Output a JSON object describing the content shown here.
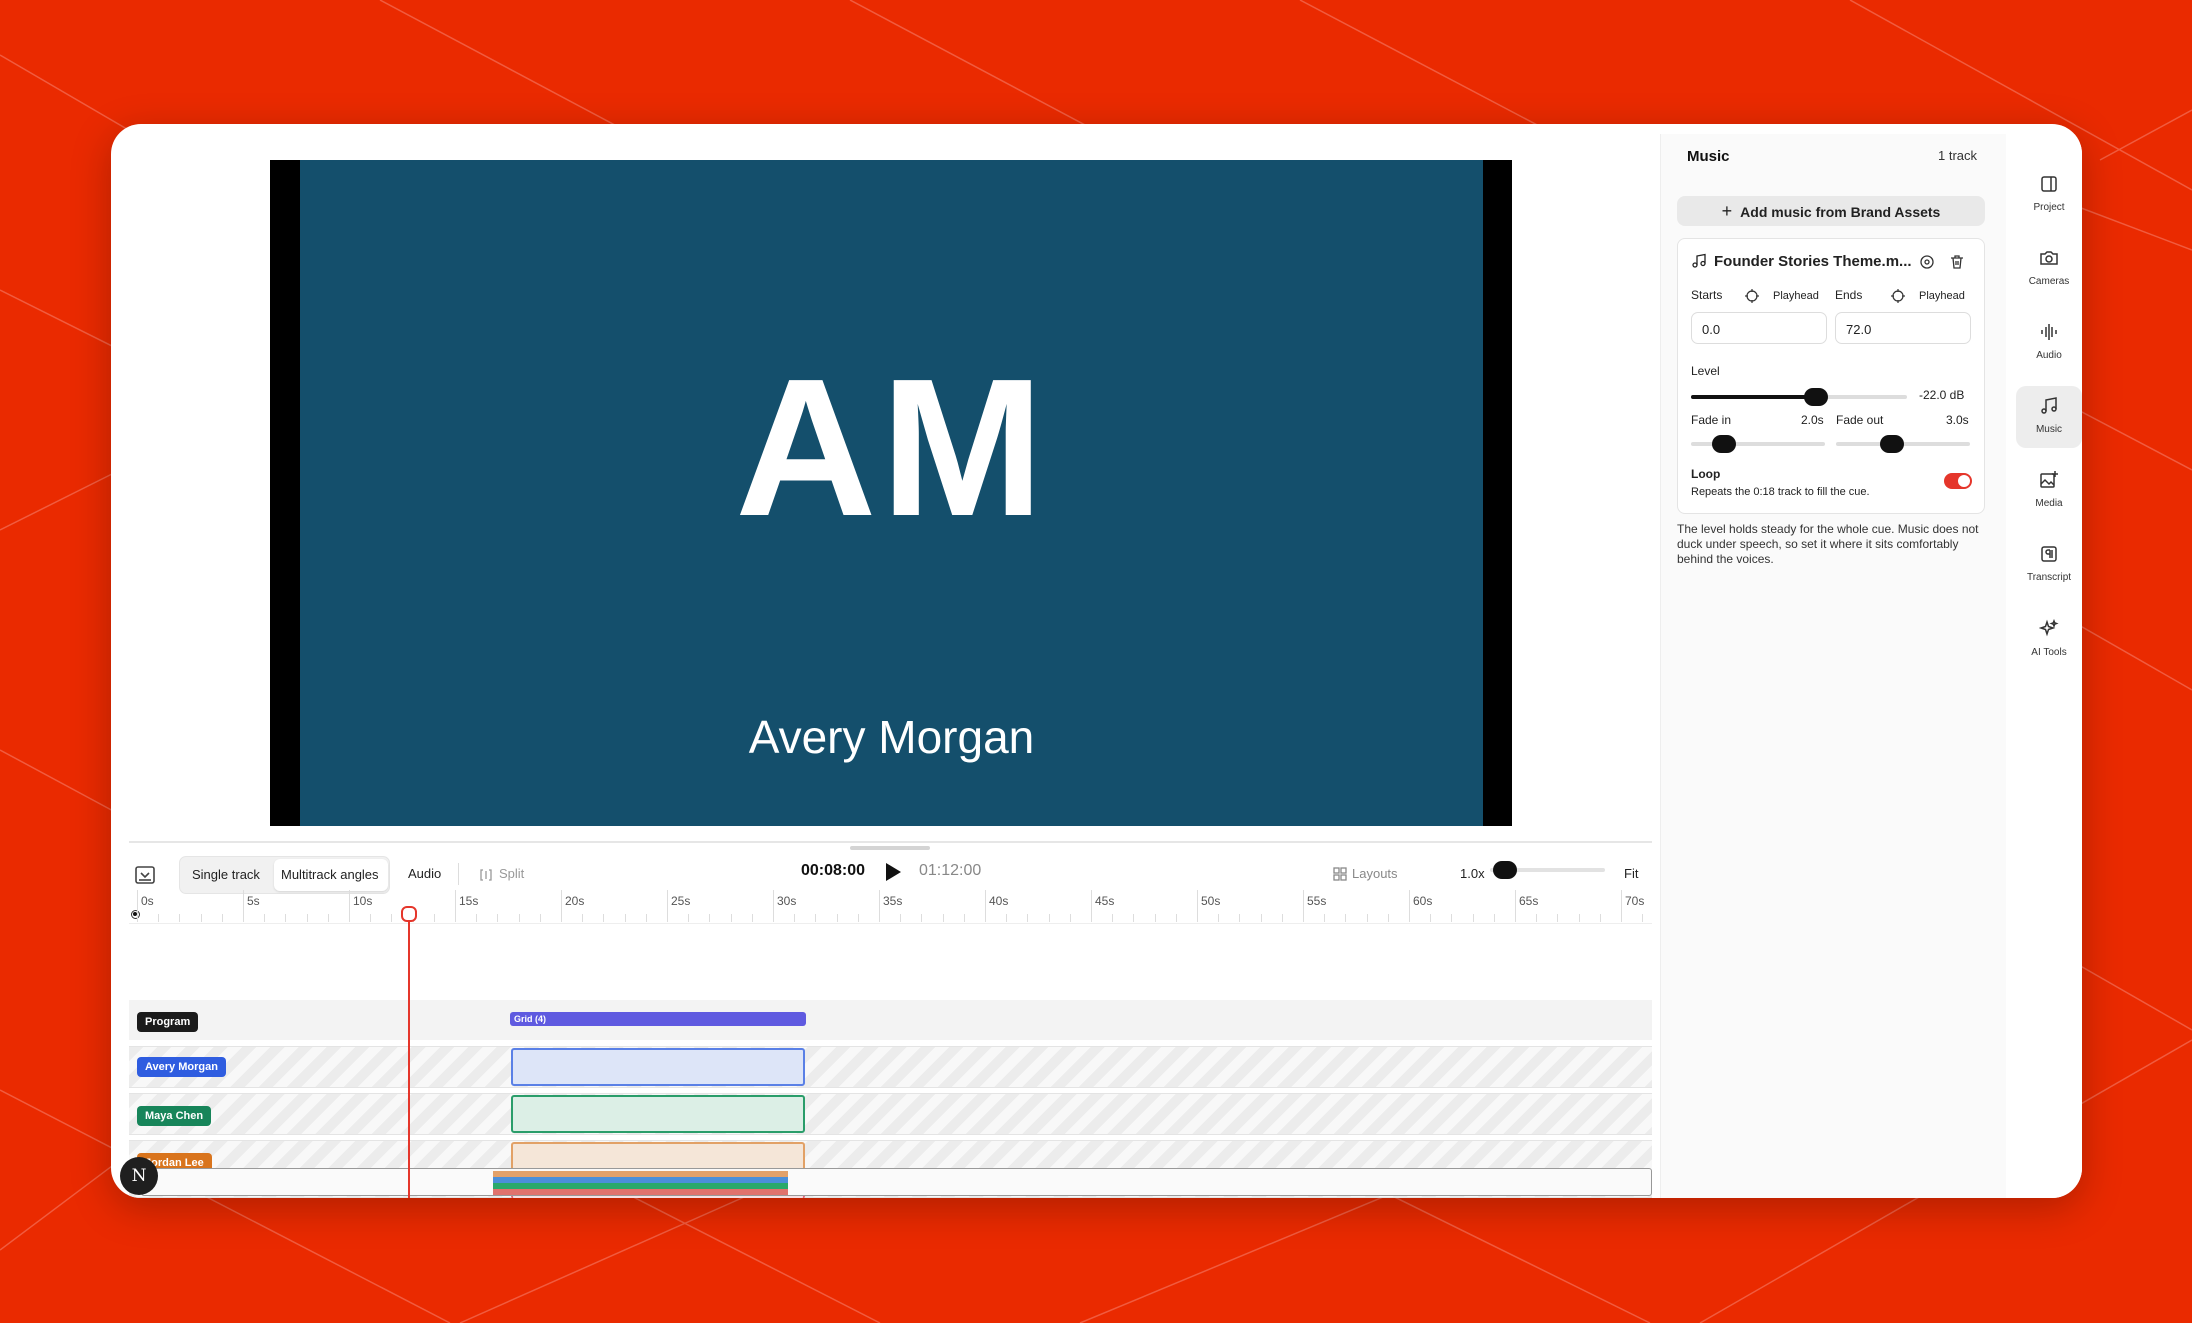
{
  "preview": {
    "monogram": "AM",
    "name": "Avery Morgan"
  },
  "toolbar": {
    "single_track": "Single track",
    "multitrack": "Multitrack angles",
    "audio": "Audio",
    "split": "Split",
    "current_time": "00:08:00",
    "duration": "01:12:00",
    "layouts": "Layouts",
    "zoom": "1.0x",
    "fit": "Fit"
  },
  "ruler": [
    "0s",
    "5s",
    "10s",
    "15s",
    "20s",
    "25s",
    "30s",
    "35s",
    "40s",
    "45s",
    "50s",
    "55s",
    "60s",
    "65s",
    "70s"
  ],
  "tracks": {
    "program": "Program",
    "grid_clip": "Grid (4)",
    "lanes": [
      "Avery Morgan",
      "Maya Chen",
      "Jordan Lee"
    ]
  },
  "colors": {
    "accent": "#e5362b",
    "avery": "#2f5de0",
    "maya": "#17855a",
    "jordan": "#d9741c",
    "grid": "#5f5ae0"
  },
  "avatar": "N",
  "music": {
    "title": "Music",
    "count": "1 track",
    "add_button": "Add music from Brand Assets",
    "file_name": "Founder Stories Theme.m...",
    "starts_label": "Starts",
    "ends_label": "Ends",
    "playhead_label": "Playhead",
    "starts_value": "0.0",
    "ends_value": "72.0",
    "level_label": "Level",
    "level_value": "-22.0 dB",
    "level_fraction": 0.58,
    "fade_in_label": "Fade in",
    "fade_in_value": "2.0s",
    "fade_out_label": "Fade out",
    "fade_out_value": "3.0s",
    "loop_label": "Loop",
    "loop_desc": "Repeats the 0:18 track to fill the cue.",
    "loop_on": true,
    "note": "The level holds steady for the whole cue. Music does not duck under speech, so set it where it sits comfortably behind the voices."
  },
  "rail": [
    {
      "label": "Project",
      "icon": "panel-icon"
    },
    {
      "label": "Cameras",
      "icon": "camera-icon"
    },
    {
      "label": "Audio",
      "icon": "waveform-icon"
    },
    {
      "label": "Music",
      "icon": "music-note-icon"
    },
    {
      "label": "Media",
      "icon": "image-plus-icon"
    },
    {
      "label": "Transcript",
      "icon": "paragraph-icon"
    },
    {
      "label": "AI Tools",
      "icon": "sparkles-icon"
    }
  ]
}
